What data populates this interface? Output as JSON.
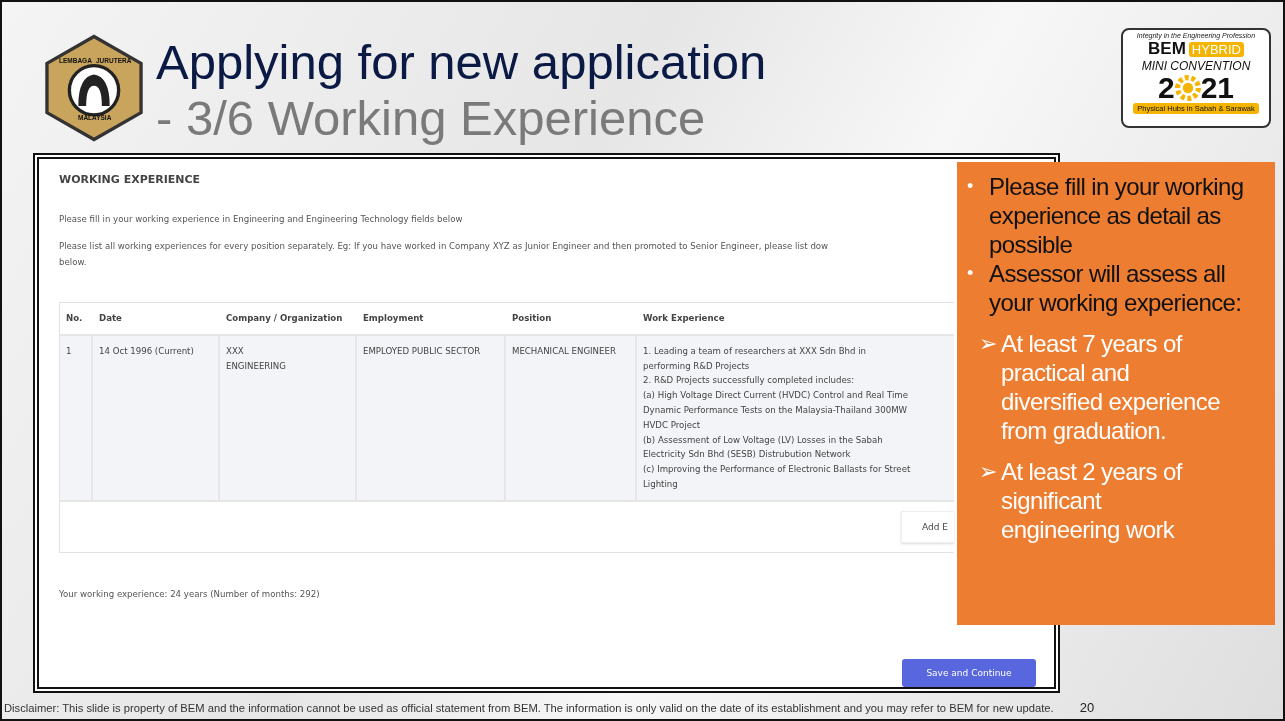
{
  "slide": {
    "title": "Applying for new application",
    "subtitle": "- 3/6 Working Experience",
    "page_number": "20",
    "disclaimer": "Disclaimer: This slide is property of BEM and the information cannot be used as official statement from BEM. The information is only valid on the date of its establishment and you may refer to BEM for new update."
  },
  "left_logo": {
    "texts": [
      "LEMBAGA",
      "JURUTERA",
      "MALAYSIA"
    ]
  },
  "right_logo": {
    "tagline": "Integrity in the Engineering Profession",
    "brand": "BEM",
    "badge": "HYBRID",
    "event": "MINI CONVENTION",
    "year_start": "2",
    "year_end": "21",
    "footer": "Physical Hubs in Sabah & Sarawak"
  },
  "form": {
    "heading": "WORKING EXPERIENCE",
    "intro": "Please fill in your working experience in Engineering and Engineering Technology fields below",
    "instruction": "Please list all working experiences for every position separately. Eg: If you have worked in Company XYZ as Junior Engineer and then promoted to Senior Engineer, please list dow\nbelow.",
    "table": {
      "columns": [
        "No.",
        "Date",
        "Company / Organization",
        "Employment",
        "Position",
        "Work Experience"
      ],
      "rows": [
        [
          "1",
          "14 Oct 1996 (Current)",
          "XXX\nENGINEERING",
          "EMPLOYED PUBLIC SECTOR",
          "MECHANICAL ENGINEER",
          "1. Leading a team of researchers at XXX Sdn Bhd in\nperforming R&D Projects\n2. R&D Projects successfully completed includes:\n(a) High Voltage Direct Current (HVDC) Control and Real Time\nDynamic Performance Tests on the Malaysia-Thailand 300MW\nHVDC Project\n(b) Assessment of Low Voltage (LV) Losses in the Sabah\nElectricity Sdn Bhd (SESB) Distrubution Network\n(c) Improving the Performance of Electronic Ballasts for Street\nLighting"
        ]
      ]
    },
    "add_button": "Add E",
    "summary": "Your working experience: 24 years (Number of months: 292)",
    "save_button": "Save and Continue"
  },
  "notes": [
    {
      "kind": "bullet",
      "marker": "•",
      "text": "Please fill in your working experience as detail as possible"
    },
    {
      "kind": "bullet",
      "marker": "•",
      "text": "Assessor will assess all your working experience:"
    },
    {
      "kind": "sub",
      "marker": "➢",
      "text": "At least 7 years of practical and diversified experience from graduation."
    },
    {
      "kind": "sub",
      "marker": "➢",
      "text": "At least 2 years of significant engineering work"
    }
  ]
}
